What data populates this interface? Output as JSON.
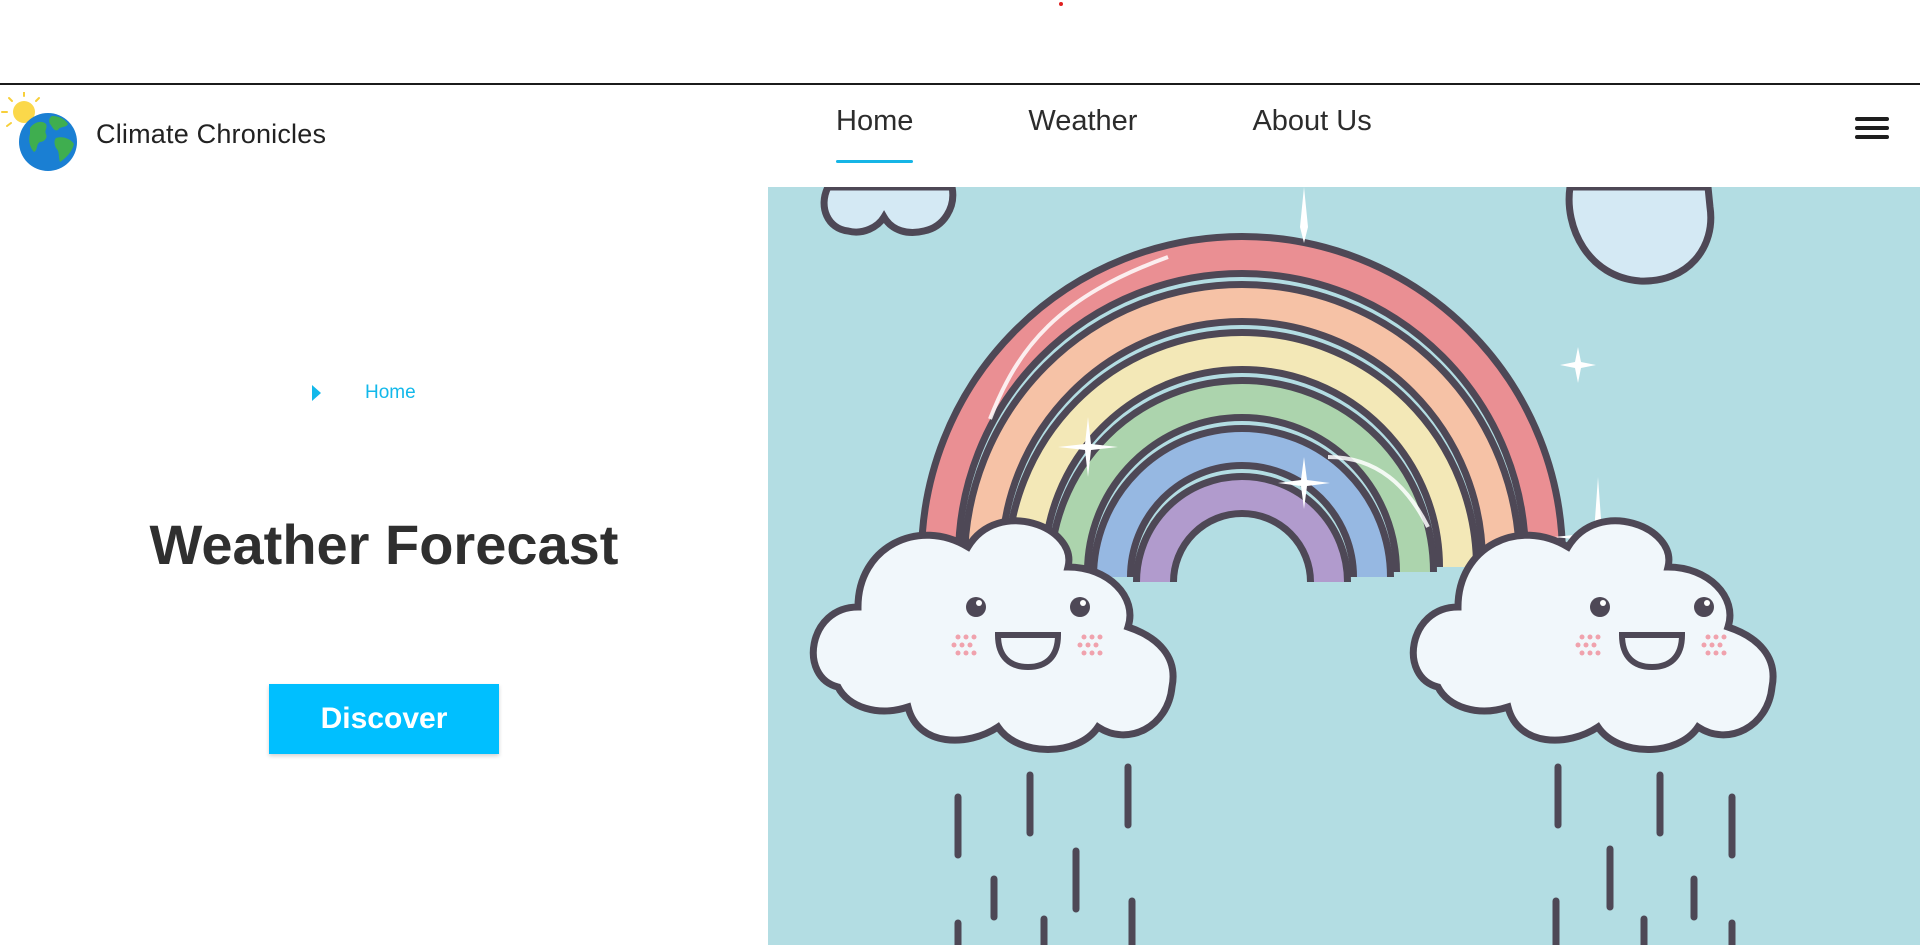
{
  "site": {
    "name": "Climate Chronicles"
  },
  "nav": {
    "items": [
      {
        "label": "Home",
        "active": true
      },
      {
        "label": "Weather",
        "active": false
      },
      {
        "label": "About Us",
        "active": false
      }
    ]
  },
  "breadcrumb": {
    "items": [
      "Home"
    ]
  },
  "hero": {
    "title": "Weather Forecast",
    "cta_label": "Discover"
  },
  "icons": {
    "logo": "globe-with-sun-icon",
    "menu": "hamburger-menu-icon",
    "breadcrumb": "caret-right-icon",
    "illustration": "rainbow-with-smiling-rain-clouds"
  },
  "colors": {
    "accent": "#00bfff",
    "link_accent": "#12b8ea",
    "art_background": "#b3dde3"
  }
}
